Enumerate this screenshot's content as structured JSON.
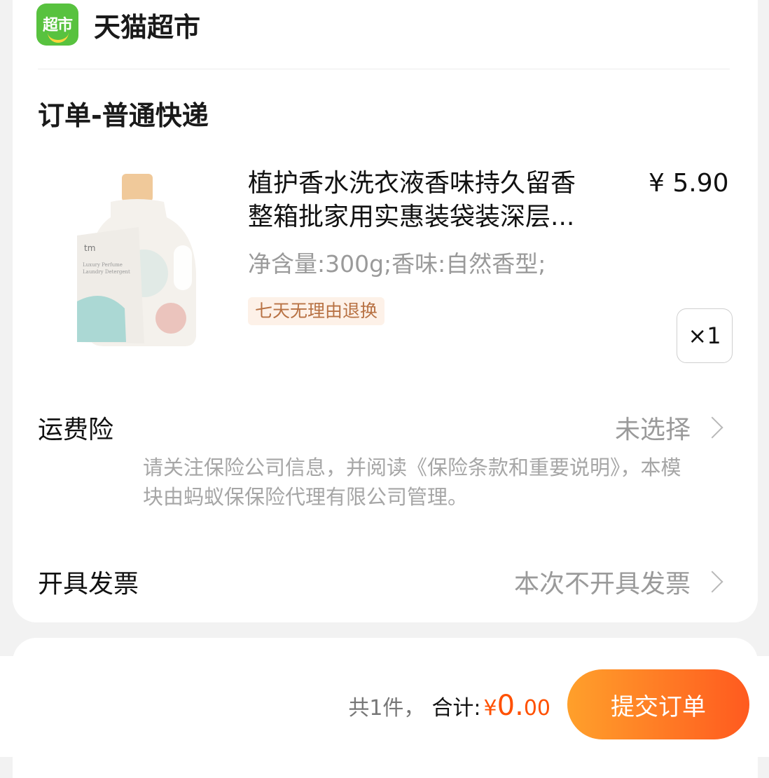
{
  "store": {
    "logo_text": "超市",
    "name": "天猫超市"
  },
  "order": {
    "section_title": "订单-普通快递"
  },
  "product": {
    "title_line1": "植护香水洗衣液香味持久留香",
    "title_line2": "整箱批家用实惠装袋装深层...",
    "price": "¥ 5.90",
    "spec": "净含量:300g;香味:自然香型;",
    "tag": "七天无理由退换",
    "quantity": "×1",
    "image_brand": "tm",
    "image_label_line1": "Luxury Perfume",
    "image_label_line2": "Laundry Detergent"
  },
  "shipping_insurance": {
    "label": "运费险",
    "value": "未选择",
    "note": "请关注保险公司信息，并阅读《保险条款和重要说明》，本模块由蚂蚁保保险代理有限公司管理。"
  },
  "invoice": {
    "label": "开具发票",
    "value": "本次不开具发票"
  },
  "footer": {
    "count": "共1件，",
    "total_label": "合计:",
    "currency": "¥",
    "amount_int": "0.",
    "amount_dec": "00",
    "submit_label": "提交订单"
  },
  "colors": {
    "accent": "#ff5000",
    "tmall_green": "#58c23f",
    "tag_bg": "#fdf1e8"
  }
}
